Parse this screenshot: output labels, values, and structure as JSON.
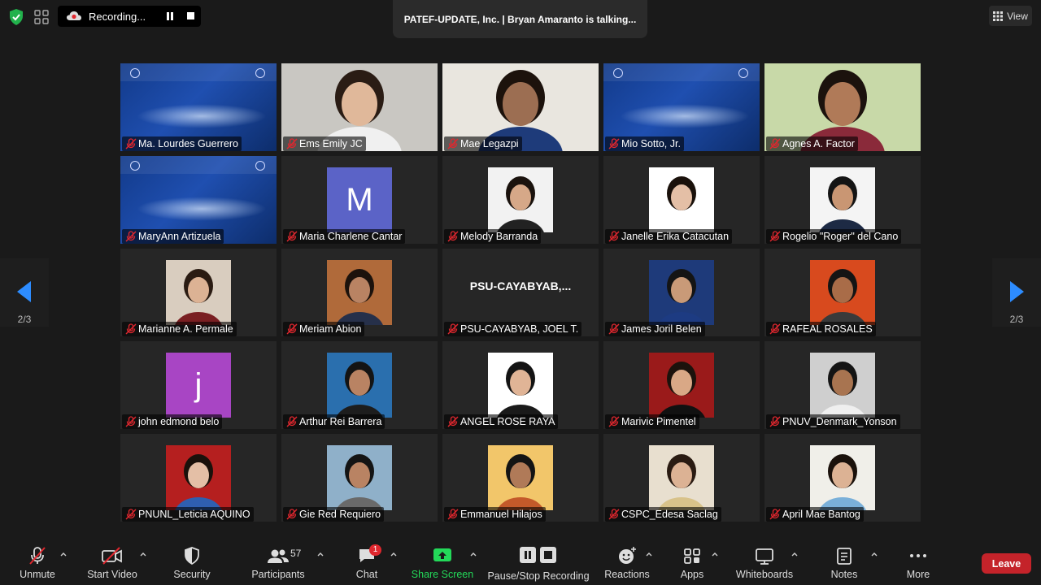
{
  "top": {
    "recording_label": "Recording...",
    "talking_banner": "PATEF-UPDATE, Inc. | Bryan Amaranto is talking...",
    "view_label": "View"
  },
  "nav": {
    "page_left": "2/3",
    "page_right": "2/3"
  },
  "participants": [
    {
      "name": "Ma. Lourdes Guerrero",
      "kind": "slide"
    },
    {
      "name": "Ems Emily JC",
      "kind": "video",
      "bg": "#c9c7c2",
      "skin": "#e0b89a",
      "hair": "#2a1c14",
      "shirt": "#f0f0f0"
    },
    {
      "name": "Mae Legazpi",
      "kind": "video",
      "bg": "#e9e6df",
      "skin": "#9c6e52",
      "hair": "#1c120c",
      "shirt": "#1e3b7a"
    },
    {
      "name": "Mio Sotto, Jr.",
      "kind": "slide"
    },
    {
      "name": "Agnes A. Factor",
      "kind": "video",
      "bg": "#c8d9a8",
      "skin": "#b07a58",
      "hair": "#1b120d",
      "shirt": "#8a2a3a"
    },
    {
      "name": "MaryAnn Artizuela",
      "kind": "slide"
    },
    {
      "name": "Maria Charlene Cantar",
      "kind": "initial",
      "initial": "M",
      "color": "#5b63c7"
    },
    {
      "name": "Melody Barranda",
      "kind": "photo",
      "bg": "#f2f2f2",
      "skin": "#d6a888",
      "hair": "#1a120d",
      "shirt": "#222222"
    },
    {
      "name": "Janelle Erika Catacutan",
      "kind": "photo",
      "bg": "#ffffff",
      "skin": "#e4bfa6",
      "hair": "#1a110b",
      "shirt": "#ffffff"
    },
    {
      "name": "Rogelio \"Roger\" del Cano",
      "kind": "photo",
      "bg": "#f4f4f4",
      "skin": "#c99673",
      "hair": "#141414",
      "shirt": "#1d2a44"
    },
    {
      "name": "Marianne A.  Permale",
      "kind": "photo",
      "bg": "#d9cdbf",
      "skin": "#dcb294",
      "hair": "#2a1b12",
      "shirt": "#7a1f22"
    },
    {
      "name": "Meriam Abion",
      "kind": "photo",
      "bg": "#b06a3a",
      "skin": "#b98363",
      "hair": "#1c120c",
      "shirt": "#26304a"
    },
    {
      "name": "PSU-CAYABYAB, JOEL T.",
      "kind": "text",
      "display": "PSU-CAYABYAB,..."
    },
    {
      "name": "James Joril Belen",
      "kind": "photo",
      "bg": "#1e3a7a",
      "skin": "#c99a78",
      "hair": "#141414",
      "shirt": "#1d3b82"
    },
    {
      "name": "RAFEAL ROSALES",
      "kind": "photo",
      "bg": "#d84a1e",
      "skin": "#a96c48",
      "hair": "#141414",
      "shirt": "#3a3a3a"
    },
    {
      "name": "john edmond belo",
      "kind": "initial",
      "initial": "j",
      "color": "#a845c4"
    },
    {
      "name": "Arthur Rei Barrera",
      "kind": "photo",
      "bg": "#2a6fae",
      "skin": "#b98363",
      "hair": "#141414",
      "shirt": "#1d1d1d"
    },
    {
      "name": "ANGEL ROSE RAYA",
      "kind": "photo",
      "bg": "#ffffff",
      "skin": "#e0b496",
      "hair": "#141414",
      "shirt": "#1a1a1a"
    },
    {
      "name": "Marivic Pimentel",
      "kind": "photo",
      "bg": "#9a1a1a",
      "skin": "#d9a886",
      "hair": "#1c120c",
      "shirt": "#111111"
    },
    {
      "name": "PNUV_Denmark_Yonson",
      "kind": "photo",
      "bg": "#cfcfcf",
      "skin": "#a87450",
      "hair": "#141414",
      "shirt": "#efefef"
    },
    {
      "name": "PNUNL_Leticia AQUINO",
      "kind": "photo",
      "bg": "#b51f1f",
      "skin": "#e4bfa6",
      "hair": "#1a110b",
      "shirt": "#2f5fb0"
    },
    {
      "name": "Gie Red Requiero",
      "kind": "photo",
      "bg": "#8fb0c9",
      "skin": "#b98363",
      "hair": "#141414",
      "shirt": "#6a6a6a"
    },
    {
      "name": "Emmanuel Hilajos",
      "kind": "photo",
      "bg": "#f2c66a",
      "skin": "#b07a58",
      "hair": "#141414",
      "shirt": "#c45a2a"
    },
    {
      "name": "CSPC_Edesa Saclag",
      "kind": "photo",
      "bg": "#e8dfcf",
      "skin": "#dcb294",
      "hair": "#2a1b12",
      "shirt": "#d8c28a"
    },
    {
      "name": "April Mae Bantog",
      "kind": "photo",
      "bg": "#f0efe9",
      "skin": "#dcb294",
      "hair": "#1a110b",
      "shirt": "#7ab0d9"
    }
  ],
  "toolbar": {
    "unmute": "Unmute",
    "start_video": "Start Video",
    "security": "Security",
    "participants": "Participants",
    "participants_count": "57",
    "chat": "Chat",
    "chat_badge": "1",
    "share_screen": "Share Screen",
    "pause_stop": "Pause/Stop Recording",
    "reactions": "Reactions",
    "apps": "Apps",
    "whiteboards": "Whiteboards",
    "notes": "Notes",
    "more": "More",
    "leave": "Leave"
  },
  "colors": {
    "share_green": "#23d959",
    "leave_red": "#c4232a",
    "nav_blue": "#2d8cff"
  }
}
